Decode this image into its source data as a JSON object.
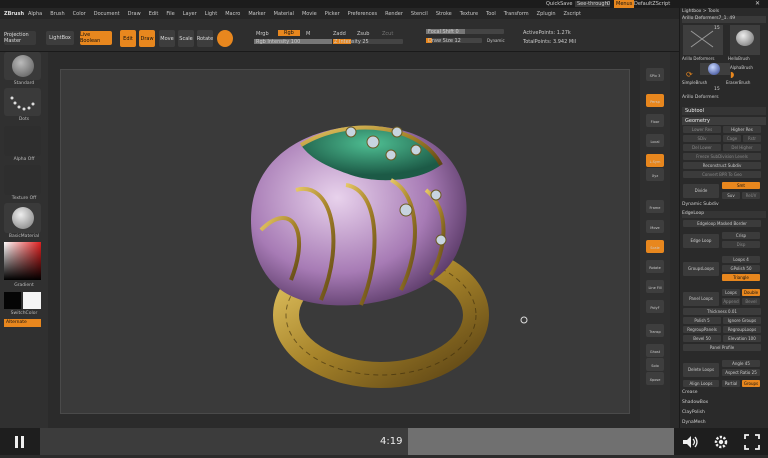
{
  "titlebar": {
    "app_logo": "ZBrush",
    "quicksave": "QuickSave",
    "seethrough": "See-through",
    "seethrough_value": "0",
    "menus": "Menus",
    "default_zscript": "DefaultZScript"
  },
  "menubar": {
    "items": [
      "Alpha",
      "Brush",
      "Color",
      "Document",
      "Draw",
      "Edit",
      "File",
      "Layer",
      "Light",
      "Macro",
      "Marker",
      "Material",
      "Movie",
      "Picker",
      "Preferences",
      "Render",
      "Stencil",
      "Stroke",
      "Texture",
      "Tool",
      "Transform",
      "Zplugin",
      "Zscript"
    ]
  },
  "toolbar": {
    "projection_master": "Projection Master",
    "lightbox": "LightBox",
    "live_boolean": "Live Boolean",
    "edit": "Edit",
    "draw": "Draw",
    "move": "Move",
    "scale": "Scale",
    "rotate": "Rotate",
    "mrgb": "Mrgb",
    "rgb": "Rgb",
    "m": "M",
    "zadd": "Zadd",
    "zsub": "Zsub",
    "zcut": "Zcut",
    "rgb_intensity": "Rgb Intensity 100",
    "z_intensity": "Z Intensity 25",
    "focal_shift": "Focal Shift 0",
    "draw_size": "Draw Size 12",
    "dynamic": "Dynamic",
    "active_points": "ActivePoints: 1.27k",
    "total_points": "TotalPoints: 3.942 Mil"
  },
  "leftshelf": {
    "standard": "Standard",
    "dots": "Dots",
    "alpha_off": "Alpha Off",
    "texture_off": "Texture Off",
    "basic_material": "BasicMaterial",
    "gradient": "Gradient",
    "switch_color": "SwitchColor",
    "alternate": "Alternate"
  },
  "rightshelf": {
    "items": [
      "SPix 3",
      "Persp",
      "Floor",
      "Local",
      "L.Sym",
      "Xyz",
      "Frame",
      "Move",
      "Scale",
      "Rotate",
      "Line Fill",
      "PolyF",
      "Transp",
      "Ghost",
      "Solo",
      "Xpose"
    ]
  },
  "palette": {
    "lightbox_tools": "Lightbox > Tools",
    "current_tool": "Arillo Deformers7_1.  49",
    "brush_count": "15",
    "tool_names": [
      "Arillo Deformers",
      "HelloBrush",
      "AlphaBrush",
      "SimpleBrush",
      "EraserBrush"
    ],
    "tool_count_2": "15",
    "arillo_deformers_2": "Arillo Deformers",
    "subtool": "Subtool",
    "geometry": "Geometry",
    "lower_res": "Lower Res",
    "higher_res": "Higher Res",
    "sdiv": "SDiv",
    "cage": "Cage",
    "rstr": "Rstr",
    "del_lower": "Del Lower",
    "del_higher": "Del Higher",
    "freeze_subdiv": "Freeze SubDivision Levels",
    "reconstruct_subdiv": "Reconstruct Subdiv",
    "convert_bpr": "Convert BPR To Geo",
    "divide": "Divide",
    "smt": "Smt",
    "suv": "Suv",
    "relax": "ReUV",
    "dynamic_subdiv": "Dynamic Subdiv",
    "edgeloop": "EdgeLoop",
    "edgeloop_masked": "Edgeloop Masked Border",
    "edge_loop": "Edge Loop",
    "crisp": "Crisp",
    "disp": "Disp",
    "groups_loops": "GroupsLoops",
    "loops": "Loops 4",
    "gpolish": "GPolish 50",
    "triangle": "Triangle",
    "panel_loops": "Panel Loops",
    "loops2": "Loops",
    "double": "Double",
    "append": "Append",
    "bevel": "Bevel",
    "thickness": "Thickness 0.01",
    "polish": "Polish 5",
    "ignore_groups": "Ignore Groups",
    "regroup_panels": "RegroupPanels",
    "regroup_loops": "RegroupLoops",
    "bevel2": "Bevel 50",
    "elevation": "Elevation 100",
    "panel_profile": "Panel Profile",
    "delete_loops": "Delete Loops",
    "angle": "Angle 45",
    "aspect_ratio": "Aspect Ratio 25",
    "align_loops": "Align Loops",
    "partial": "Partial",
    "groups": "Groups",
    "crease": "Crease",
    "shadowbox": "ShadowBox",
    "claypolish": "ClayPolish",
    "dynamesh": "DynaMesh"
  },
  "video": {
    "timecode": "4:19",
    "progress": 0.55
  },
  "colors": {
    "accent": "#e8871e",
    "ring_gold": "#b8962e",
    "petal_purple": "#9a6fa8",
    "enamel_green": "#2a8a6a"
  },
  "icons": {
    "play_pause": "pause-icon",
    "volume": "volume-icon",
    "settings": "gear-icon",
    "fullscreen": "fullscreen-icon"
  }
}
